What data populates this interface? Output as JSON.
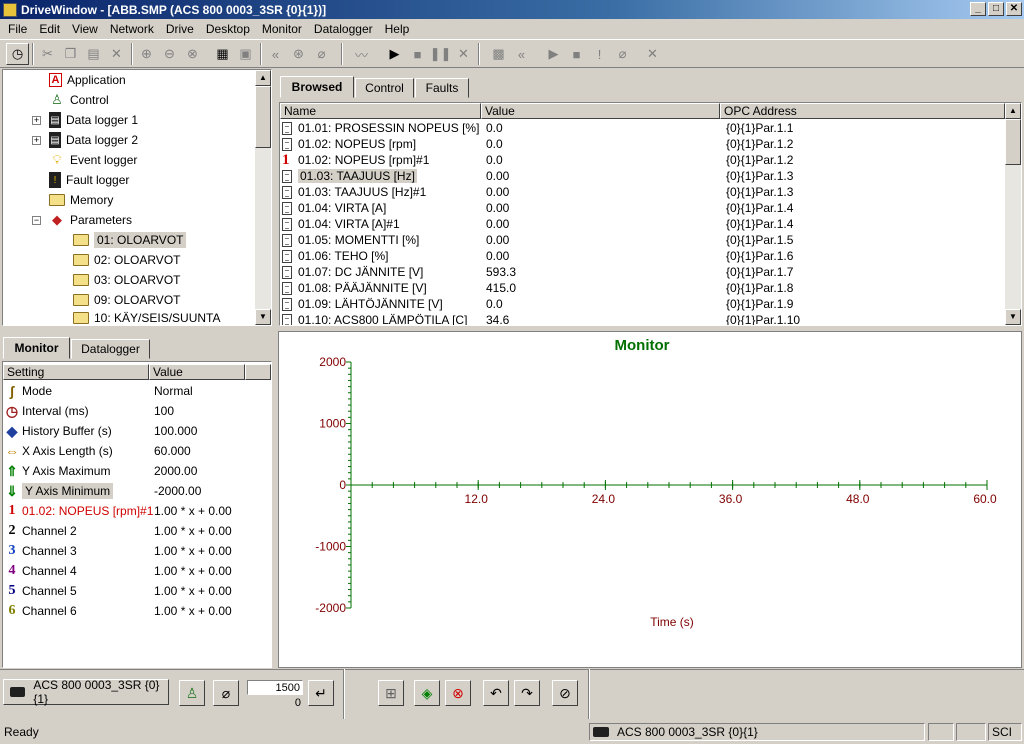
{
  "window": {
    "title": "DriveWindow - [ABB.SMP (ACS 800 0003_3SR {0}{1})]"
  },
  "menu": [
    "File",
    "Edit",
    "View",
    "Network",
    "Drive",
    "Desktop",
    "Monitor",
    "Datalogger",
    "Help"
  ],
  "tree": {
    "items": [
      {
        "label": "Application",
        "icon": "application-icon"
      },
      {
        "label": "Control",
        "icon": "joystick-icon"
      },
      {
        "label": "Data logger 1",
        "icon": "datalogger-icon"
      },
      {
        "label": "Data logger 2",
        "icon": "datalogger-icon"
      },
      {
        "label": "Event logger",
        "icon": "lightbulb-icon"
      },
      {
        "label": "Fault logger",
        "icon": "fault-logger-icon"
      },
      {
        "label": "Memory",
        "icon": "folder-icon"
      },
      {
        "label": "Parameters",
        "icon": "book-icon"
      },
      {
        "label": "01: OLOARVOT",
        "icon": "folder-icon"
      },
      {
        "label": "02: OLOARVOT",
        "icon": "folder-icon"
      },
      {
        "label": "03: OLOARVOT",
        "icon": "folder-icon"
      },
      {
        "label": "09: OLOARVOT",
        "icon": "folder-icon"
      },
      {
        "label": "10: KÄY/SEIS/SUUNTA",
        "icon": "folder-icon"
      }
    ]
  },
  "top_tabs": [
    "Browsed",
    "Control",
    "Faults"
  ],
  "params": {
    "headers": [
      "Name",
      "Value",
      "OPC Address"
    ],
    "rows": [
      {
        "name": "01.01: PROSESSIN NOPEUS [%]",
        "value": "0.0",
        "opc": "{0}{1}Par.1.1"
      },
      {
        "name": "01.02: NOPEUS [rpm]",
        "value": "0.0",
        "opc": "{0}{1}Par.1.2"
      },
      {
        "name": "01.02: NOPEUS [rpm]#1",
        "value": "0.0",
        "opc": "{0}{1}Par.1.2"
      },
      {
        "name": "01.03: TAAJUUS [Hz]",
        "value": "0.00",
        "opc": "{0}{1}Par.1.3"
      },
      {
        "name": "01.03: TAAJUUS [Hz]#1",
        "value": "0.00",
        "opc": "{0}{1}Par.1.3"
      },
      {
        "name": "01.04: VIRTA [A]",
        "value": "0.00",
        "opc": "{0}{1}Par.1.4"
      },
      {
        "name": "01.04: VIRTA [A]#1",
        "value": "0.00",
        "opc": "{0}{1}Par.1.4"
      },
      {
        "name": "01.05: MOMENTTI [%]",
        "value": "0.00",
        "opc": "{0}{1}Par.1.5"
      },
      {
        "name": "01.06: TEHO [%]",
        "value": "0.00",
        "opc": "{0}{1}Par.1.6"
      },
      {
        "name": "01.07: DC JÄNNITE [V]",
        "value": "593.3",
        "opc": "{0}{1}Par.1.7"
      },
      {
        "name": "01.08: PÄÄJÄNNITE [V]",
        "value": "415.0",
        "opc": "{0}{1}Par.1.8"
      },
      {
        "name": "01.09: LÄHTÖJÄNNITE [V]",
        "value": "0.0",
        "opc": "{0}{1}Par.1.9"
      },
      {
        "name": "01.10: ACS800 LÄMPÖTILA [C]",
        "value": "34.6",
        "opc": "{0}{1}Par.1.10"
      }
    ]
  },
  "left_tabs": [
    "Monitor",
    "Datalogger"
  ],
  "settings": {
    "headers": [
      "Setting",
      "Value"
    ],
    "rows": [
      {
        "label": "Mode",
        "value": "Normal",
        "icon": "mode-icon",
        "glyph": "ʃ",
        "color": "#806000"
      },
      {
        "label": "Interval (ms)",
        "value": "100",
        "icon": "clock-icon",
        "glyph": "◷",
        "color": "#a02020"
      },
      {
        "label": "History Buffer (s)",
        "value": "100.000",
        "icon": "buffer-icon",
        "glyph": "◆",
        "color": "#2040a0"
      },
      {
        "label": "X Axis Length (s)",
        "value": "60.000",
        "icon": "x-axis-icon",
        "glyph": "⇔",
        "color": "#c08000"
      },
      {
        "label": "Y Axis Maximum",
        "value": "2000.00",
        "icon": "y-max-icon",
        "glyph": "⇑",
        "color": "#008000"
      },
      {
        "label": "Y Axis Minimum",
        "value": "-2000.00",
        "icon": "y-min-icon",
        "glyph": "⇓",
        "color": "#008000"
      },
      {
        "label": "01.02: NOPEUS [rpm]#1",
        "value": "1.00 * x + 0.00",
        "icon": "channel-1-icon",
        "glyph": "1",
        "color": "#d00000"
      },
      {
        "label": "Channel 2",
        "value": "1.00 * x + 0.00",
        "icon": "channel-2-icon",
        "glyph": "2",
        "color": "#000000"
      },
      {
        "label": "Channel 3",
        "value": "1.00 * x + 0.00",
        "icon": "channel-3-icon",
        "glyph": "3",
        "color": "#1040c0"
      },
      {
        "label": "Channel 4",
        "value": "1.00 * x + 0.00",
        "icon": "channel-4-icon",
        "glyph": "4",
        "color": "#800080"
      },
      {
        "label": "Channel 5",
        "value": "1.00 * x + 0.00",
        "icon": "channel-5-icon",
        "glyph": "5",
        "color": "#000080"
      },
      {
        "label": "Channel 6",
        "value": "1.00 * x + 0.00",
        "icon": "channel-6-icon",
        "glyph": "6",
        "color": "#808000"
      }
    ]
  },
  "chart_data": {
    "type": "line",
    "title": "Monitor",
    "xlabel": "Time (s)",
    "ylabel": "",
    "xlim": [
      0,
      60
    ],
    "ylim": [
      -2000,
      2000
    ],
    "xticks": [
      12.0,
      24.0,
      36.0,
      48.0,
      60.0
    ],
    "yticks": [
      2000,
      1000,
      0,
      -1000,
      -2000
    ],
    "series": [],
    "grid": false,
    "colors": {
      "title": "#007000",
      "axis": "#007000",
      "labels": "#800000"
    }
  },
  "bottom": {
    "drive_label": "ACS 800 0003_3SR {0}{1}",
    "reference_value": "1500",
    "actual_value": "0"
  },
  "status": {
    "text": "Ready",
    "drive": "ACS 800 0003_3SR {0}{1}",
    "indicator": "SCI"
  }
}
